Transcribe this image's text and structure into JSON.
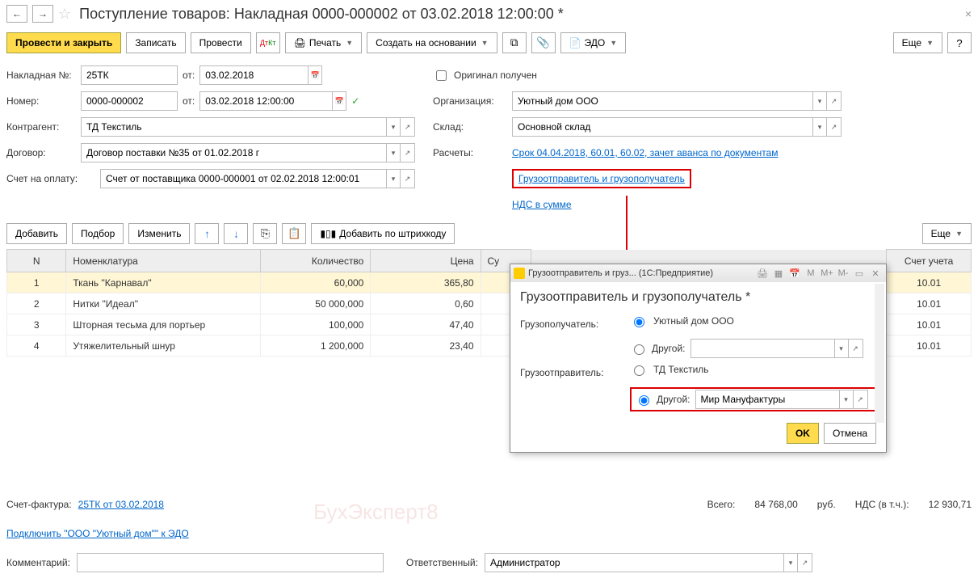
{
  "header": {
    "title": "Поступление товаров: Накладная 0000-000002 от 03.02.2018 12:00:00 *"
  },
  "toolbar": {
    "post_and_close": "Провести и закрыть",
    "save": "Записать",
    "post": "Провести",
    "print": "Печать",
    "create_based": "Создать на основании",
    "edo": "ЭДО",
    "more": "Еще"
  },
  "form": {
    "invoice_no_label": "Накладная №:",
    "invoice_no": "25ТК",
    "from_label": "от:",
    "invoice_date": "03.02.2018",
    "number_label": "Номер:",
    "number": "0000-000002",
    "number_date": "03.02.2018 12:00:00",
    "counterparty_label": "Контрагент:",
    "counterparty": "ТД Текстиль",
    "contract_label": "Договор:",
    "contract": "Договор поставки №35 от 01.02.2018 г",
    "bill_label": "Счет на оплату:",
    "bill": "Счет от поставщика 0000-000001 от 02.02.2018 12:00:01",
    "original_label": "Оригинал получен",
    "org_label": "Организация:",
    "org": "Уютный дом ООО",
    "warehouse_label": "Склад:",
    "warehouse": "Основной склад",
    "settlements_label": "Расчеты:",
    "settlements_link": "Срок 04.04.2018, 60.01, 60.02, зачет аванса по документам",
    "shipper_link": "Грузоотправитель и грузополучатель",
    "vat_link": "НДС в сумме"
  },
  "table_toolbar": {
    "add": "Добавить",
    "pick": "Подбор",
    "edit": "Изменить",
    "barcode": "Добавить по штрихкоду",
    "more": "Еще"
  },
  "table": {
    "headers": {
      "n": "N",
      "nomenclature": "Номенклатура",
      "qty": "Количество",
      "price": "Цена",
      "sum": "Су",
      "account": "Счет учета"
    },
    "rows": [
      {
        "n": "1",
        "name": "Ткань \"Карнавал\"",
        "qty": "60,000",
        "price": "365,80",
        "account": "10.01"
      },
      {
        "n": "2",
        "name": "Нитки \"Идеал\"",
        "qty": "50 000,000",
        "price": "0,60",
        "account": "10.01"
      },
      {
        "n": "3",
        "name": "Шторная тесьма для портьер",
        "qty": "100,000",
        "price": "47,40",
        "account": "10.01"
      },
      {
        "n": "4",
        "name": "Утяжелительный шнур",
        "qty": "1 200,000",
        "price": "23,40",
        "account": "10.01"
      }
    ]
  },
  "modal": {
    "windowtitle": "Грузоотправитель и груз... (1С:Предприятие)",
    "title": "Грузоотправитель и грузополучатель *",
    "consignee_label": "Грузополучатель:",
    "consignee_opt1": "Уютный дом ООО",
    "other_label": "Другой:",
    "shipper_label": "Грузоотправитель:",
    "shipper_opt1": "ТД Текстиль",
    "shipper_other_value": "Мир Мануфактуры",
    "ok": "OK",
    "cancel": "Отмена",
    "m": "M",
    "mplus": "M+",
    "mminus": "M-"
  },
  "footer": {
    "invoice_label": "Счет-фактура:",
    "invoice_link": "25ТК от 03.02.2018",
    "edo_link": "Подключить \"ООО \"Уютный дом\"\" к ЭДО",
    "comment_label": "Комментарий:",
    "responsible_label": "Ответственный:",
    "responsible": "Администратор",
    "total_label": "Всего:",
    "total": "84 768,00",
    "currency": "руб.",
    "vat_label": "НДС (в т.ч.):",
    "vat": "12 930,71"
  },
  "watermark": "БухЭксперт8"
}
